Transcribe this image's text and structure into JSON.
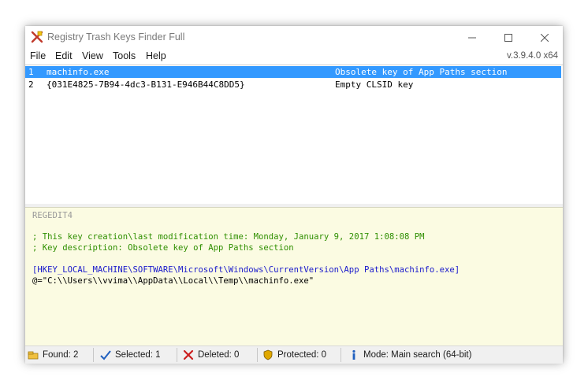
{
  "window": {
    "title": "Registry Trash Keys Finder Full"
  },
  "menu": {
    "items": [
      "File",
      "Edit",
      "View",
      "Tools",
      "Help"
    ],
    "version": "v.3.9.4.0 x64"
  },
  "results": [
    {
      "num": "1",
      "key": "machinfo.exe",
      "description": "Obsolete key of App Paths section",
      "selected": true
    },
    {
      "num": "2",
      "key": "{031E4825-7B94-4dc3-B131-E946B44C8DD5}",
      "description": "Empty CLSID key",
      "selected": false
    }
  ],
  "registry": {
    "header": "REGEDIT4",
    "comment1": "; This key creation\\last modification time: Monday, January 9, 2017 1:08:08 PM",
    "comment2": "; Key description: Obsolete key of App Paths section",
    "key_path": "[HKEY_LOCAL_MACHINE\\SOFTWARE\\Microsoft\\Windows\\CurrentVersion\\App Paths\\machinfo.exe]",
    "value_line": "@=\"C:\\\\Users\\\\vvima\\\\AppData\\\\Local\\\\Temp\\\\machinfo.exe\""
  },
  "status": {
    "found": "Found: 2",
    "selected": "Selected: 1",
    "deleted": "Deleted: 0",
    "protected": "Protected: 0",
    "mode": "Mode: Main search (64-bit)"
  },
  "colors": {
    "selection": "#3399ff",
    "registry_bg": "#fbfbe2",
    "comment": "#2f8f00",
    "key_path": "#1a1acc",
    "header": "#999999"
  }
}
